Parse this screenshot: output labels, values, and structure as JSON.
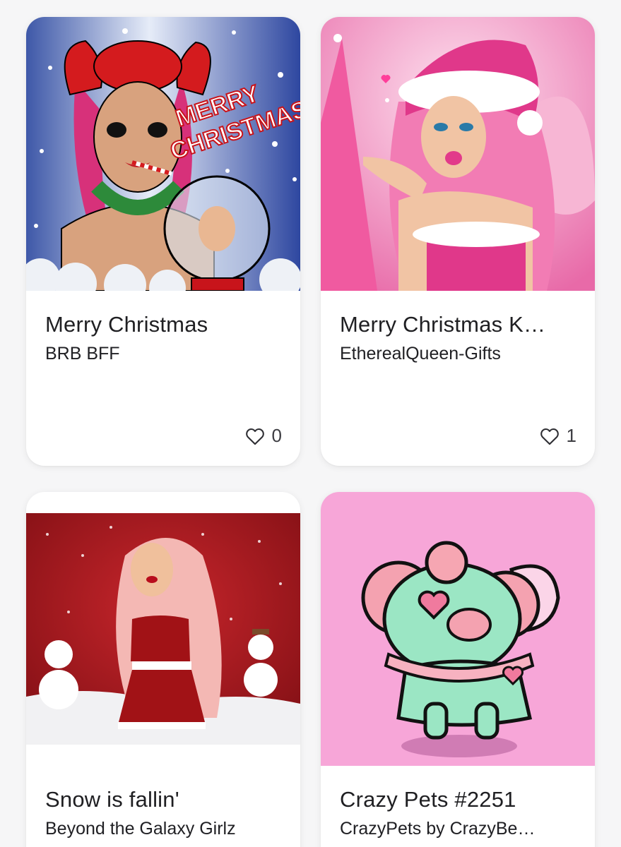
{
  "cards": [
    {
      "title": "Merry Christmas",
      "creator": "BRB BFF",
      "likes": "0",
      "art_text_1": "MERRY",
      "art_text_2": "CHRISTMAS",
      "icon": "heart-outline-icon"
    },
    {
      "title": "Merry Christmas K…",
      "creator": "EtherealQueen-Gifts",
      "likes": "1",
      "icon": "heart-outline-icon"
    },
    {
      "title": "Snow is fallin'",
      "creator": "Beyond the Galaxy Girlz"
    },
    {
      "title": "Crazy Pets #2251",
      "creator": "CrazyPets by CrazyBe…"
    }
  ],
  "colors": {
    "page_bg": "#f6f6f7",
    "card_bg": "#ffffff",
    "text_primary": "#1f1f22",
    "pink_bg": "#f7a6d8",
    "christmas_red": "#b5141c"
  }
}
